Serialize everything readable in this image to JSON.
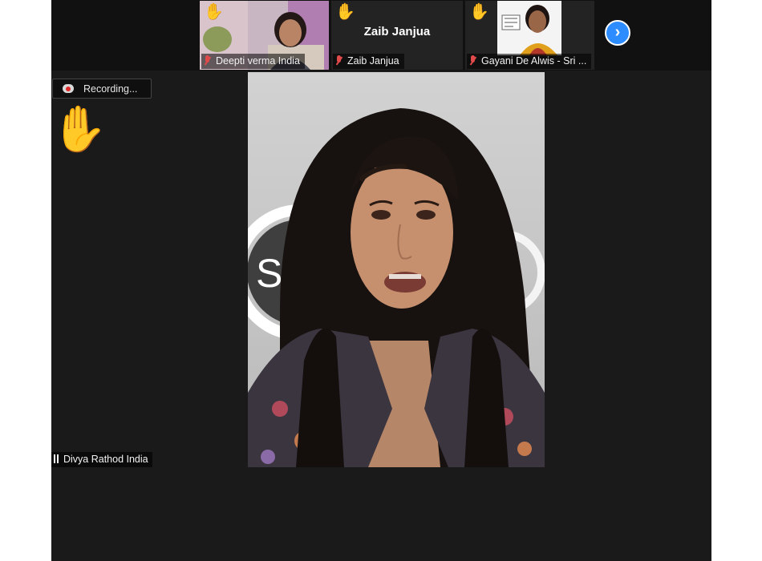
{
  "participants_strip": {
    "tiles": [
      {
        "name": "Deepti verma India",
        "hand_icon": "raised-hand-icon",
        "muted": true
      },
      {
        "name": "Zaib Janjua",
        "title": "Zaib Janjua",
        "hand_icon": "raised-hand-icon",
        "muted": true
      },
      {
        "name": "Gayani De Alwis - Sri ...",
        "hand_icon": "raised-hand-icon",
        "muted": true
      }
    ],
    "next_icon": "chevron-right-icon",
    "next_glyph": "›"
  },
  "recording": {
    "label": "Recording...",
    "icon": "cloud-record-icon"
  },
  "active_speaker": {
    "name": "Divya Rathod India",
    "hand_icon": "raised-hand-icon",
    "audio_icon": "audio-bars-icon",
    "background_text": "Sil"
  },
  "glyphs": {
    "hand": "✋"
  },
  "colors": {
    "background": "#1a1a1a",
    "accent": "#2d8cff",
    "muted": "#e04a4a"
  }
}
